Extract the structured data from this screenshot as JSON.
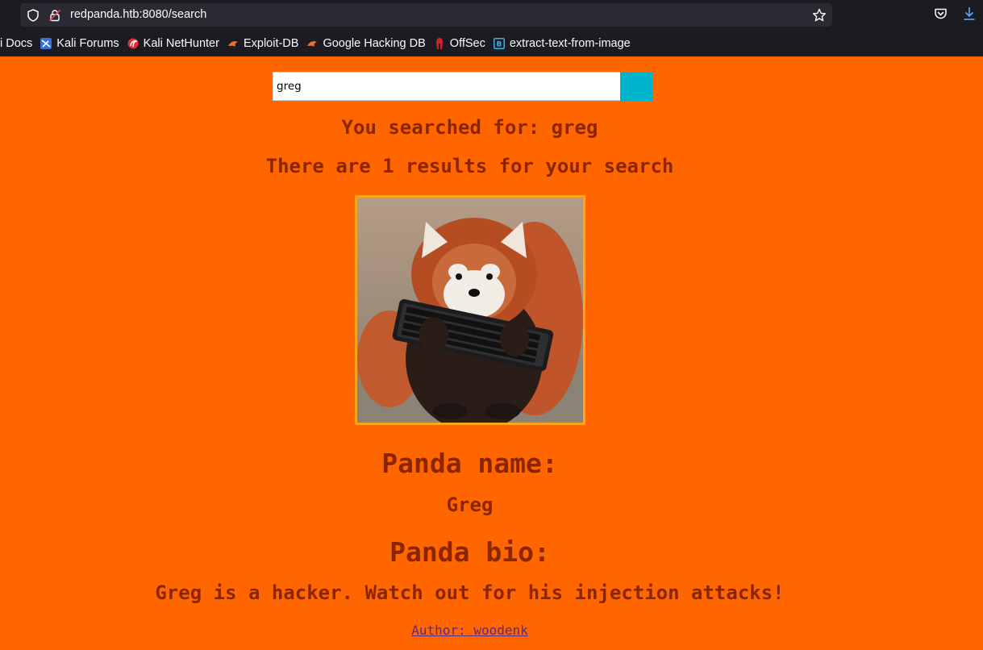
{
  "browser": {
    "url": "redpanda.htb:8080/search",
    "bookmarks": [
      {
        "label": "i Docs",
        "icon": "kali-docs-icon"
      },
      {
        "label": "Kali Forums",
        "icon": "kali-forums-icon"
      },
      {
        "label": "Kali NetHunter",
        "icon": "kali-nethunter-icon"
      },
      {
        "label": "Exploit-DB",
        "icon": "exploit-db-icon"
      },
      {
        "label": "Google Hacking DB",
        "icon": "ghdb-icon"
      },
      {
        "label": "OffSec",
        "icon": "offsec-icon"
      },
      {
        "label": "extract-text-from-image",
        "icon": "extract-text-icon"
      }
    ]
  },
  "search": {
    "value": "greg"
  },
  "results": {
    "searched_for": "You searched for: greg",
    "count_text": "There are 1 results for your search"
  },
  "panda": {
    "name_heading": "Panda name:",
    "name": "Greg",
    "bio_heading": "Panda bio:",
    "bio": "Greg is a hacker. Watch out for his injection attacks!",
    "author": "Author: woodenk"
  },
  "colors": {
    "page_background": "#ff6600",
    "text": "#8b2500",
    "search_button": "#00b4cc",
    "image_border": "#ffa31a",
    "link": "#5a2a82"
  }
}
